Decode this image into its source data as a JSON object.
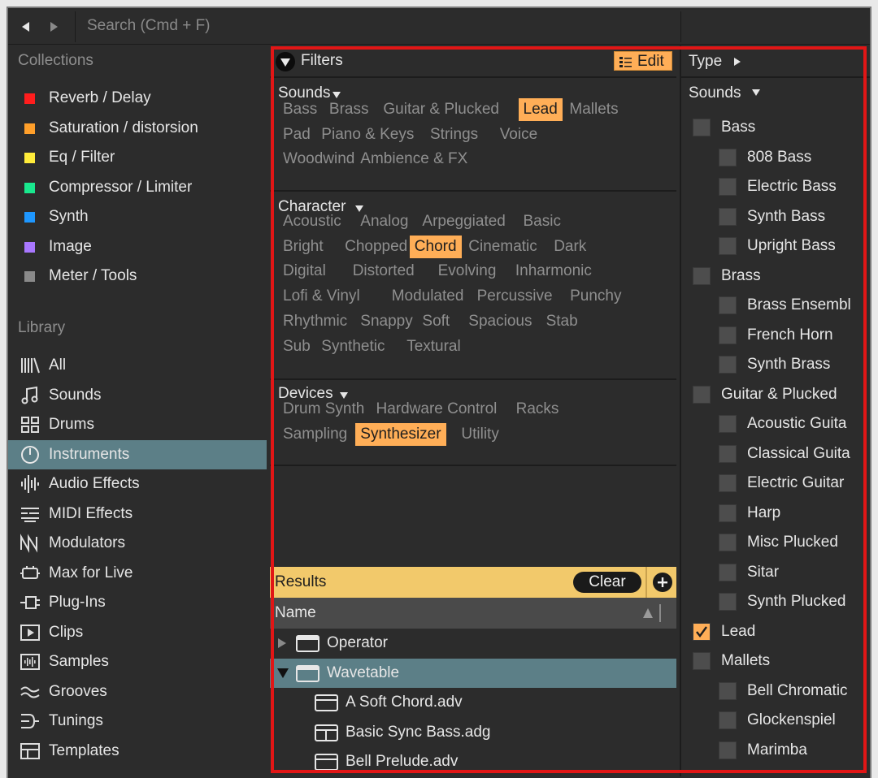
{
  "search": {
    "placeholder": "Search (Cmd + F)"
  },
  "nav": {
    "back_icon": "back-arrow-icon",
    "forward_icon": "forward-arrow-icon"
  },
  "sidebar": {
    "collections_title": "Collections",
    "collections": [
      {
        "label": "Reverb / Delay",
        "color": "#ff1d1d"
      },
      {
        "label": "Saturation / distorsion",
        "color": "#ff9f2a"
      },
      {
        "label": "Eq / Filter",
        "color": "#ffec3a"
      },
      {
        "label": "Compressor / Limiter",
        "color": "#19e88e"
      },
      {
        "label": "Synth",
        "color": "#1e97ff"
      },
      {
        "label": "Image",
        "color": "#a877ff"
      },
      {
        "label": "Meter / Tools",
        "color": "#8a8a8a"
      }
    ],
    "library_title": "Library",
    "library": [
      {
        "label": "All",
        "icon": "all-icon"
      },
      {
        "label": "Sounds",
        "icon": "sounds-icon"
      },
      {
        "label": "Drums",
        "icon": "drums-icon"
      },
      {
        "label": "Instruments",
        "icon": "instruments-icon",
        "active": true
      },
      {
        "label": "Audio Effects",
        "icon": "audio-effects-icon"
      },
      {
        "label": "MIDI Effects",
        "icon": "midi-effects-icon"
      },
      {
        "label": "Modulators",
        "icon": "modulators-icon"
      },
      {
        "label": "Max for Live",
        "icon": "max-for-live-icon"
      },
      {
        "label": "Plug-Ins",
        "icon": "plug-ins-icon"
      },
      {
        "label": "Clips",
        "icon": "clips-icon"
      },
      {
        "label": "Samples",
        "icon": "samples-icon"
      },
      {
        "label": "Grooves",
        "icon": "grooves-icon"
      },
      {
        "label": "Tunings",
        "icon": "tunings-icon"
      },
      {
        "label": "Templates",
        "icon": "templates-icon"
      }
    ]
  },
  "filters": {
    "title": "Filters",
    "edit_label": "Edit",
    "sounds": {
      "title": "Sounds",
      "rows": [
        [
          {
            "label": "Bass"
          },
          {
            "label": "Brass"
          },
          {
            "label": "Guitar & Plucked"
          },
          {
            "label": "Lead",
            "selected": true
          },
          {
            "label": "Mallets"
          }
        ],
        [
          {
            "label": "Pad"
          },
          {
            "label": "Piano & Keys"
          },
          {
            "label": "Strings"
          },
          {
            "label": "Voice"
          }
        ],
        [
          {
            "label": "Woodwind"
          },
          {
            "label": "Ambience & FX"
          }
        ]
      ]
    },
    "character": {
      "title": "Character",
      "rows": [
        [
          {
            "label": "Acoustic"
          },
          {
            "label": "Analog"
          },
          {
            "label": "Arpeggiated"
          },
          {
            "label": "Basic"
          }
        ],
        [
          {
            "label": "Bright"
          },
          {
            "label": "Chopped"
          },
          {
            "label": "Chord",
            "selected": true
          },
          {
            "label": "Cinematic"
          },
          {
            "label": "Dark"
          }
        ],
        [
          {
            "label": "Digital"
          },
          {
            "label": "Distorted"
          },
          {
            "label": "Evolving"
          },
          {
            "label": "Inharmonic"
          }
        ],
        [
          {
            "label": "Lofi & Vinyl"
          },
          {
            "label": "Modulated"
          },
          {
            "label": "Percussive"
          },
          {
            "label": "Punchy"
          }
        ],
        [
          {
            "label": "Rhythmic"
          },
          {
            "label": "Snappy"
          },
          {
            "label": "Soft"
          },
          {
            "label": "Spacious"
          },
          {
            "label": "Stab"
          }
        ],
        [
          {
            "label": "Sub"
          },
          {
            "label": "Synthetic"
          },
          {
            "label": "Textural"
          }
        ]
      ]
    },
    "devices": {
      "title": "Devices",
      "rows": [
        [
          {
            "label": "Drum Synth"
          },
          {
            "label": "Hardware Control"
          },
          {
            "label": "Racks"
          }
        ],
        [
          {
            "label": "Sampling"
          },
          {
            "label": "Synthesizer",
            "selected": true
          },
          {
            "label": "Utility"
          }
        ]
      ]
    }
  },
  "results": {
    "title": "Results",
    "clear_label": "Clear",
    "name_header": "Name",
    "rows": [
      {
        "label": "Operator",
        "expanded": false,
        "level": 0
      },
      {
        "label": "Wavetable",
        "expanded": true,
        "level": 0,
        "active": true
      },
      {
        "label": "A Soft Chord.adv",
        "level": 1
      },
      {
        "label": "Basic Sync Bass.adg",
        "level": 1
      },
      {
        "label": "Bell Prelude.adv",
        "level": 1
      }
    ]
  },
  "type_panel": {
    "title": "Type",
    "sounds_title": "Sounds",
    "items": [
      {
        "label": "Bass",
        "level": 0,
        "checked": false
      },
      {
        "label": "808 Bass",
        "level": 1,
        "checked": false
      },
      {
        "label": "Electric Bass",
        "level": 1,
        "checked": false
      },
      {
        "label": "Synth Bass",
        "level": 1,
        "checked": false
      },
      {
        "label": "Upright Bass",
        "level": 1,
        "checked": false
      },
      {
        "label": "Brass",
        "level": 0,
        "checked": false
      },
      {
        "label": "Brass Ensembl",
        "level": 1,
        "checked": false
      },
      {
        "label": "French Horn",
        "level": 1,
        "checked": false
      },
      {
        "label": "Synth Brass",
        "level": 1,
        "checked": false
      },
      {
        "label": "Guitar & Plucked",
        "level": 0,
        "checked": false
      },
      {
        "label": "Acoustic Guita",
        "level": 1,
        "checked": false
      },
      {
        "label": "Classical Guita",
        "level": 1,
        "checked": false
      },
      {
        "label": "Electric Guitar",
        "level": 1,
        "checked": false
      },
      {
        "label": "Harp",
        "level": 1,
        "checked": false
      },
      {
        "label": "Misc Plucked",
        "level": 1,
        "checked": false
      },
      {
        "label": "Sitar",
        "level": 1,
        "checked": false
      },
      {
        "label": "Synth Plucked",
        "level": 1,
        "checked": false
      },
      {
        "label": "Lead",
        "level": 0,
        "checked": true
      },
      {
        "label": "Mallets",
        "level": 0,
        "checked": false
      },
      {
        "label": "Bell Chromatic",
        "level": 1,
        "checked": false
      },
      {
        "label": "Glockenspiel",
        "level": 1,
        "checked": false
      },
      {
        "label": "Marimba",
        "level": 1,
        "checked": false
      }
    ]
  },
  "colors": {
    "accent": "#ffae57",
    "results_bar": "#f2c96b",
    "active_row": "#5c7f87",
    "highlight_frame": "#e11616"
  }
}
